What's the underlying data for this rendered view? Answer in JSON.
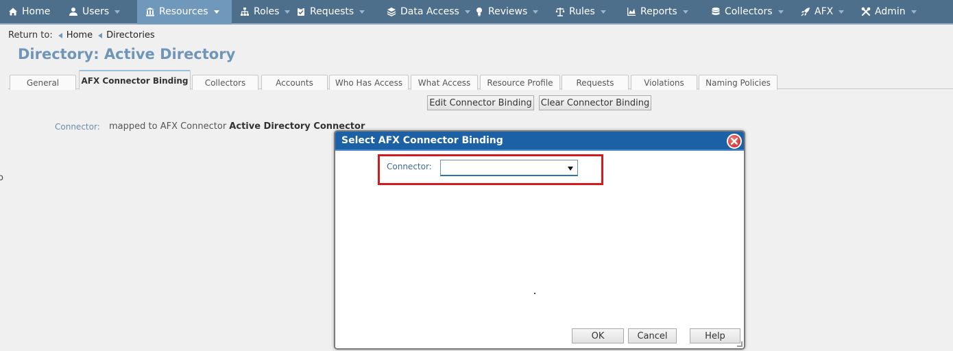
{
  "nav": [
    {
      "key": "home",
      "label": "Home",
      "icon": "home-icon",
      "caret": false,
      "active": false
    },
    {
      "key": "users",
      "label": "Users",
      "icon": "user-icon",
      "caret": true,
      "active": false
    },
    {
      "key": "resources",
      "label": "Resources",
      "icon": "building-icon",
      "caret": true,
      "active": true
    },
    {
      "key": "roles",
      "label": "Roles",
      "icon": "sitemap-icon",
      "caret": true,
      "active": false
    },
    {
      "key": "requests",
      "label": "Requests",
      "icon": "clipboard-check-icon",
      "caret": true,
      "active": false
    },
    {
      "key": "data-access",
      "label": "Data Access",
      "icon": "layers-icon",
      "caret": true,
      "active": false
    },
    {
      "key": "reviews",
      "label": "Reviews",
      "icon": "lightbulb-icon",
      "caret": true,
      "active": false
    },
    {
      "key": "rules",
      "label": "Rules",
      "icon": "scale-icon",
      "caret": true,
      "active": false
    },
    {
      "key": "reports",
      "label": "Reports",
      "icon": "chart-icon",
      "caret": true,
      "active": false
    },
    {
      "key": "collectors",
      "label": "Collectors",
      "icon": "database-icon",
      "caret": true,
      "active": false
    },
    {
      "key": "afx",
      "label": "AFX",
      "icon": "rocket-icon",
      "caret": true,
      "active": false
    },
    {
      "key": "admin",
      "label": "Admin",
      "icon": "wrench-icon",
      "caret": true,
      "active": false
    }
  ],
  "breadcrumb": {
    "prefix": "Return to:",
    "items": [
      "Home",
      "Directories"
    ]
  },
  "page_title": "Directory: Active Directory",
  "tabs": [
    {
      "label": "General",
      "active": false
    },
    {
      "label": "AFX Connector Binding",
      "active": true
    },
    {
      "label": "Collectors",
      "active": false
    },
    {
      "label": "Accounts",
      "active": false
    },
    {
      "label": "Who Has Access",
      "active": false
    },
    {
      "label": "What Access",
      "active": false
    },
    {
      "label": "Resource Profile",
      "active": false
    },
    {
      "label": "Requests",
      "active": false
    },
    {
      "label": "Violations",
      "active": false
    },
    {
      "label": "Naming Policies",
      "active": false
    }
  ],
  "actions": {
    "edit_label": "Edit Connector Binding",
    "clear_label": "Clear Connector Binding"
  },
  "connector": {
    "label": "Connector:",
    "prefix": "mapped to AFX Connector ",
    "name": "Active Directory Connector"
  },
  "stray_text": "o",
  "dialog": {
    "title": "Select AFX Connector Binding",
    "field_label": "Connector:",
    "selected_value": "",
    "ok_label": "OK",
    "cancel_label": "Cancel",
    "help_label": "Help",
    "highlight_color": "#d5191c"
  },
  "colors": {
    "nav_bg": "#4e6f8c",
    "nav_active": "#6f98bb",
    "title_color": "#6f95b8",
    "dialog_title_bg": "#1c61a6"
  }
}
